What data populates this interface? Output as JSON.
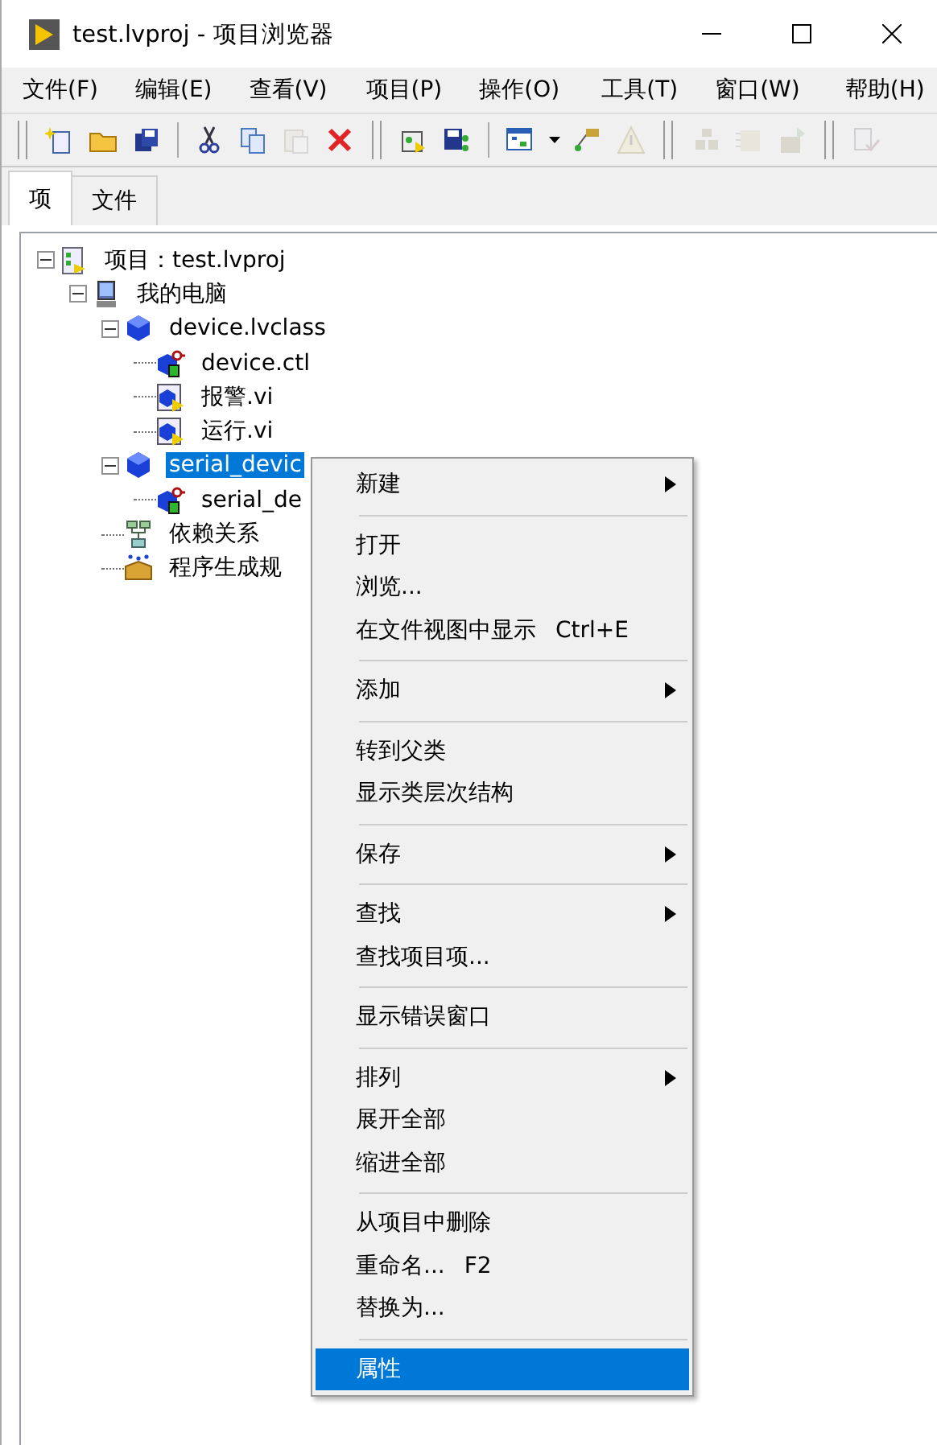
{
  "window": {
    "title": "test.lvproj - 项目浏览器"
  },
  "menu_bar": [
    "文件(F)",
    "编辑(E)",
    "查看(V)",
    "项目(P)",
    "操作(O)",
    "工具(T)",
    "窗口(W)",
    "帮助(H)"
  ],
  "toolbar": [
    [
      [
        {
          "kind": "new",
          "disabled": false
        },
        {
          "kind": "open",
          "disabled": false
        },
        {
          "kind": "save-all",
          "disabled": false
        }
      ],
      [
        {
          "kind": "cut",
          "disabled": false
        },
        {
          "kind": "copy",
          "disabled": false
        },
        {
          "kind": "paste",
          "disabled": true
        },
        {
          "kind": "delete",
          "disabled": false
        }
      ]
    ],
    [
      [
        {
          "kind": "build",
          "disabled": false
        },
        {
          "kind": "save-project",
          "disabled": false
        }
      ],
      [
        {
          "kind": "view",
          "disabled": false
        },
        {
          "kind": "caret",
          "disabled": false
        },
        {
          "kind": "hierarchy",
          "disabled": false
        },
        {
          "kind": "warning",
          "disabled": true
        }
      ]
    ],
    [
      [
        {
          "kind": "boxes",
          "disabled": true
        },
        {
          "kind": "box",
          "disabled": true
        },
        {
          "kind": "box-arrow",
          "disabled": true
        }
      ]
    ],
    [
      [
        {
          "kind": "doc-check",
          "disabled": true
        }
      ]
    ]
  ],
  "tabs": [
    {
      "label": "项",
      "selected": true
    },
    {
      "label": "文件",
      "selected": false
    }
  ],
  "tree": [
    {
      "label": "项目：test.lvproj",
      "kind": "project",
      "expanded": true,
      "selected": false,
      "children": [
        {
          "label": "我的电脑",
          "kind": "computer",
          "expanded": true,
          "selected": false,
          "children": [
            {
              "label": "device.lvclass",
              "kind": "class",
              "expanded": true,
              "selected": false,
              "children": [
                {
                  "label": "device.ctl",
                  "kind": "control",
                  "selected": false
                },
                {
                  "label": "报警.vi",
                  "kind": "vi",
                  "selected": false
                },
                {
                  "label": "运行.vi",
                  "kind": "vi",
                  "selected": false
                }
              ]
            },
            {
              "label": "serial_devic",
              "kind": "class",
              "expanded": true,
              "selected": true,
              "children": [
                {
                  "label": "serial_de",
                  "kind": "control",
                  "selected": false
                }
              ]
            },
            {
              "label": "依赖关系",
              "kind": "dependencies",
              "selected": false
            },
            {
              "label": "程序生成规",
              "kind": "build",
              "selected": false
            }
          ]
        }
      ]
    }
  ],
  "context_menu": [
    {
      "kind": "item",
      "label": "新建",
      "submenu": true,
      "selected": false
    },
    {
      "kind": "separator"
    },
    {
      "kind": "item",
      "label": "打开",
      "submenu": false,
      "selected": false
    },
    {
      "kind": "item",
      "label": "浏览...",
      "submenu": false,
      "selected": false
    },
    {
      "kind": "item",
      "label": "在文件视图中显示",
      "shortcut": "Ctrl+E",
      "submenu": false,
      "selected": false
    },
    {
      "kind": "separator"
    },
    {
      "kind": "item",
      "label": "添加",
      "submenu": true,
      "selected": false
    },
    {
      "kind": "separator"
    },
    {
      "kind": "item",
      "label": "转到父类",
      "submenu": false,
      "selected": false
    },
    {
      "kind": "item",
      "label": "显示类层次结构",
      "submenu": false,
      "selected": false
    },
    {
      "kind": "separator"
    },
    {
      "kind": "item",
      "label": "保存",
      "submenu": true,
      "selected": false
    },
    {
      "kind": "separator"
    },
    {
      "kind": "item",
      "label": "查找",
      "submenu": true,
      "selected": false
    },
    {
      "kind": "item",
      "label": "查找项目项...",
      "submenu": false,
      "selected": false
    },
    {
      "kind": "separator"
    },
    {
      "kind": "item",
      "label": "显示错误窗口",
      "submenu": false,
      "selected": false
    },
    {
      "kind": "separator"
    },
    {
      "kind": "item",
      "label": "排列",
      "submenu": true,
      "selected": false
    },
    {
      "kind": "item",
      "label": "展开全部",
      "submenu": false,
      "selected": false
    },
    {
      "kind": "item",
      "label": "缩进全部",
      "submenu": false,
      "selected": false
    },
    {
      "kind": "separator"
    },
    {
      "kind": "item",
      "label": "从项目中删除",
      "submenu": false,
      "selected": false
    },
    {
      "kind": "item",
      "label": "重命名...",
      "shortcut": "F2",
      "submenu": false,
      "selected": false
    },
    {
      "kind": "item",
      "label": "替换为...",
      "submenu": false,
      "selected": false
    },
    {
      "kind": "separator"
    },
    {
      "kind": "item",
      "label": "属性",
      "submenu": false,
      "selected": true
    }
  ]
}
